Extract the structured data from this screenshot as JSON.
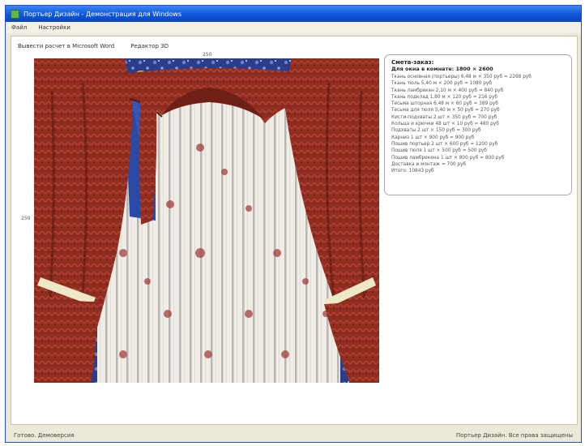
{
  "window": {
    "title": "Портьер Дизайн - Демонстрация для Windows"
  },
  "menu": {
    "items": [
      "Файл",
      "Настройки"
    ]
  },
  "toolbar": {
    "links": [
      "Вывести расчет в Microsoft Word",
      "Редактор 3D"
    ]
  },
  "ruler": {
    "top_mark": "250",
    "left_mark": "250"
  },
  "spec": {
    "title": "Смета-заказ:",
    "subtitle": "Для окна в комнате: 1800 × 2600",
    "lines": [
      "Ткань основная (портьеры) 6,48 м × 350 руб = 2268 руб",
      "Ткань тюль 5,40 м × 200 руб = 1080 руб",
      "Ткань ламбрекен 2,10 м × 400 руб = 840 руб",
      "Ткань подклад 1,80 м × 120 руб = 216 руб",
      "Тесьма шторная 6,48 м × 60 руб = 389 руб",
      "Тесьма для тюля 5,40 м × 50 руб = 270 руб",
      "Кисти-подхваты 2 шт × 350 руб = 700 руб",
      "Кольца и крючки 48 шт × 10 руб = 480 руб",
      "Подхваты 2 шт × 150 руб = 300 руб",
      "Карниз 1 шт × 900 руб = 900 руб",
      "Пошив портьер 2 шт × 600 руб = 1200 руб",
      "Пошив тюля 1 шт × 500 руб = 500 руб",
      "Пошив ламбрекена 1 шт × 800 руб = 800 руб",
      "Доставка и монтаж = 700 руб",
      "Итого: 10843 руб"
    ]
  },
  "status": {
    "left": "Готово. Демоверсия",
    "right": "Портьер Дизайн. Все права защищены"
  },
  "colors": {
    "titlebar": "#0f57d9",
    "curtain": "#8e2d20",
    "wall": "#2c3d8c",
    "tulle": "#f0ece6"
  },
  "icons": {
    "app": "window-app-icon"
  }
}
